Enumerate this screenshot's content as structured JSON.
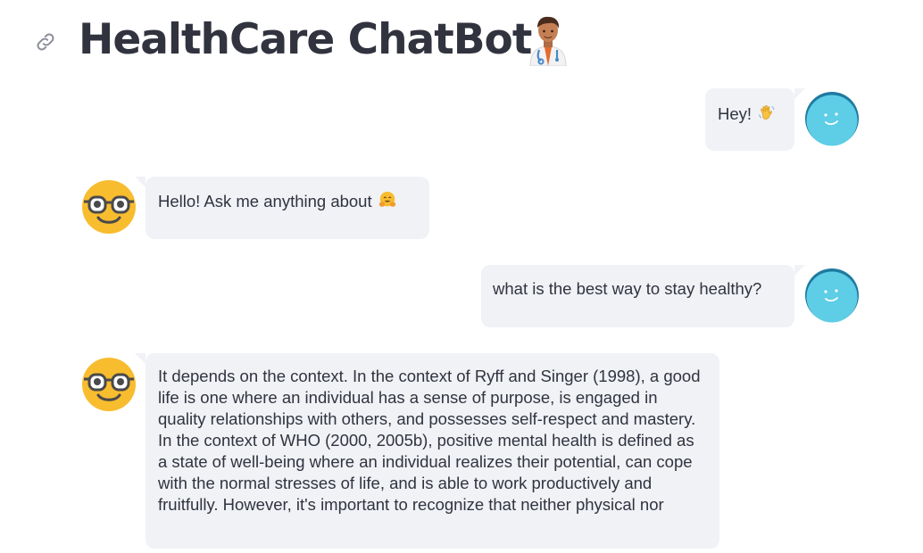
{
  "app": {
    "title": "HealthCare ChatBot",
    "title_icon": "doctor-emoji-icon",
    "anchor_icon": "link-icon"
  },
  "messages": [
    {
      "role": "user",
      "text": "Hey!",
      "emoji": "waving-hand-icon",
      "avatar": "smiling-face-avatar"
    },
    {
      "role": "bot",
      "text": "Hello! Ask me anything about",
      "emoji": "hugging-face-icon",
      "avatar": "nerd-face-avatar"
    },
    {
      "role": "user",
      "text": "what is the best way to stay healthy?",
      "avatar": "smiling-face-avatar"
    },
    {
      "role": "bot",
      "text": "It depends on the context. In the context of Ryff and Singer (1998), a good life is one where an individual has a sense of purpose, is engaged in quality relationships with others, and possesses self-respect and mastery. In the context of WHO (2000, 2005b), positive mental health is defined as a state of well-being where an individual realizes their potential, can cope with the normal stresses of life, and is able to work productively and fruitfully. However, it's important to recognize that neither physical nor",
      "avatar": "nerd-face-avatar"
    }
  ],
  "colors": {
    "bubble_bg": "#f0f2f6",
    "text": "#31333f",
    "user_avatar": "#5ecde6",
    "bot_avatar": "#f8bc2f"
  }
}
